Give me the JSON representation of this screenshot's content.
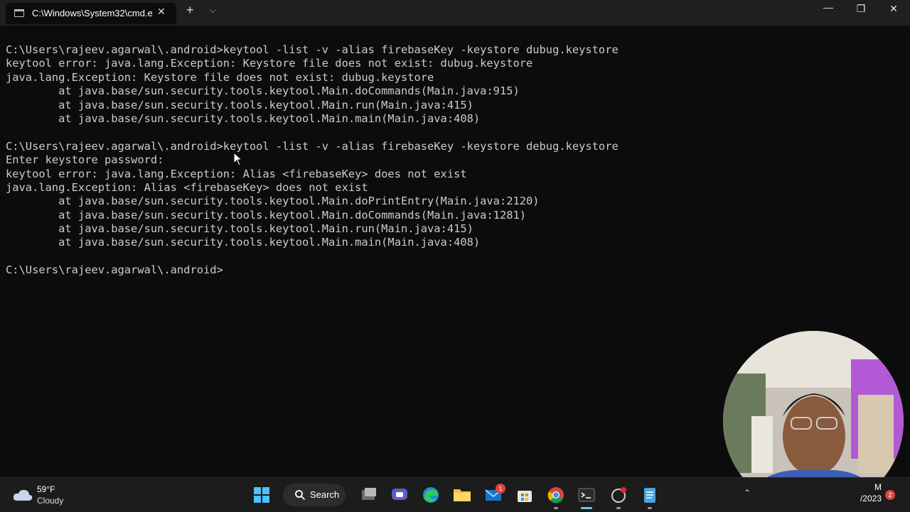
{
  "window": {
    "tab_title": "C:\\Windows\\System32\\cmd.e",
    "tab_close": "✕",
    "new_tab": "+",
    "dropdown": "⌵",
    "minimize": "—",
    "maximize": "❐",
    "close": "✕"
  },
  "terminal": {
    "lines": [
      "C:\\Users\\rajeev.agarwal\\.android>keytool -list -v -alias firebaseKey -keystore dubug.keystore",
      "keytool error: java.lang.Exception: Keystore file does not exist: dubug.keystore",
      "java.lang.Exception: Keystore file does not exist: dubug.keystore",
      "        at java.base/sun.security.tools.keytool.Main.doCommands(Main.java:915)",
      "        at java.base/sun.security.tools.keytool.Main.run(Main.java:415)",
      "        at java.base/sun.security.tools.keytool.Main.main(Main.java:408)",
      "",
      "C:\\Users\\rajeev.agarwal\\.android>keytool -list -v -alias firebaseKey -keystore debug.keystore",
      "Enter keystore password:",
      "keytool error: java.lang.Exception: Alias <firebaseKey> does not exist",
      "java.lang.Exception: Alias <firebaseKey> does not exist",
      "        at java.base/sun.security.tools.keytool.Main.doPrintEntry(Main.java:2120)",
      "        at java.base/sun.security.tools.keytool.Main.doCommands(Main.java:1281)",
      "        at java.base/sun.security.tools.keytool.Main.run(Main.java:415)",
      "        at java.base/sun.security.tools.keytool.Main.main(Main.java:408)",
      "",
      "C:\\Users\\rajeev.agarwal\\.android>"
    ]
  },
  "taskbar": {
    "weather": {
      "temp": "59°F",
      "condition": "Cloudy",
      "icon": "cloud-icon"
    },
    "search_label": "Search",
    "apps": [
      {
        "name": "start-button",
        "icon": "windows-logo-icon"
      },
      {
        "name": "task-view",
        "icon": "task-view-icon"
      },
      {
        "name": "teams-chat",
        "icon": "chat-icon"
      },
      {
        "name": "edge",
        "icon": "edge-icon"
      },
      {
        "name": "file-explorer",
        "icon": "folder-icon"
      },
      {
        "name": "mail",
        "icon": "mail-icon",
        "badge": "1"
      },
      {
        "name": "store",
        "icon": "store-icon"
      },
      {
        "name": "chrome",
        "icon": "chrome-icon"
      },
      {
        "name": "terminal",
        "icon": "terminal-icon"
      },
      {
        "name": "app-red-dot",
        "icon": "app-icon"
      },
      {
        "name": "notepad",
        "icon": "notepad-icon"
      }
    ],
    "clock_time": "M",
    "clock_date": "/2023",
    "notification_count": "2",
    "colors": {
      "accent": "#60cdff",
      "background": "#1c1c1c",
      "terminal_bg": "#0c0c0c"
    }
  }
}
